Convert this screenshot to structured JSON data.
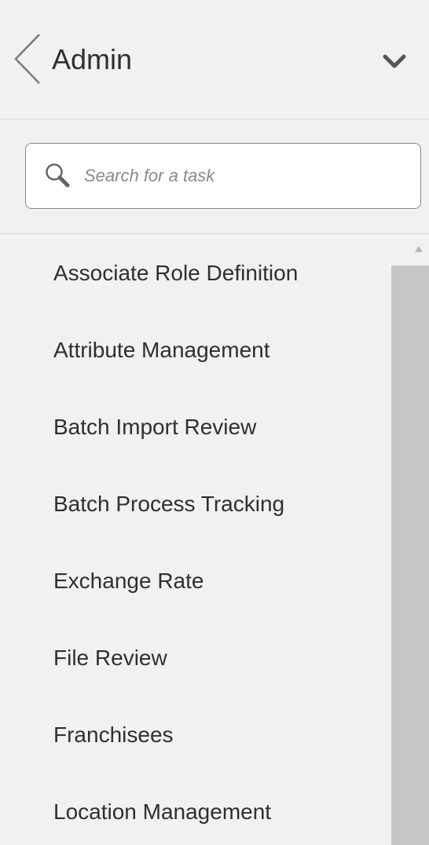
{
  "header": {
    "title": "Admin",
    "back_icon": "chevron-left-icon",
    "collapse_icon": "chevron-down-icon"
  },
  "search": {
    "placeholder": "Search for a task",
    "value": "",
    "icon": "search-icon"
  },
  "tasks": [
    "Associate Role Definition",
    "Attribute Management",
    "Batch Import Review",
    "Batch Process Tracking",
    "Exchange Rate",
    "File Review",
    "Franchisees",
    "Location Management"
  ],
  "colors": {
    "background": "#f1f1f1",
    "text": "#2f2f2f",
    "divider": "#d6d6d6",
    "scrollbar_thumb": "#c6c6c6",
    "icon": "#666666"
  }
}
